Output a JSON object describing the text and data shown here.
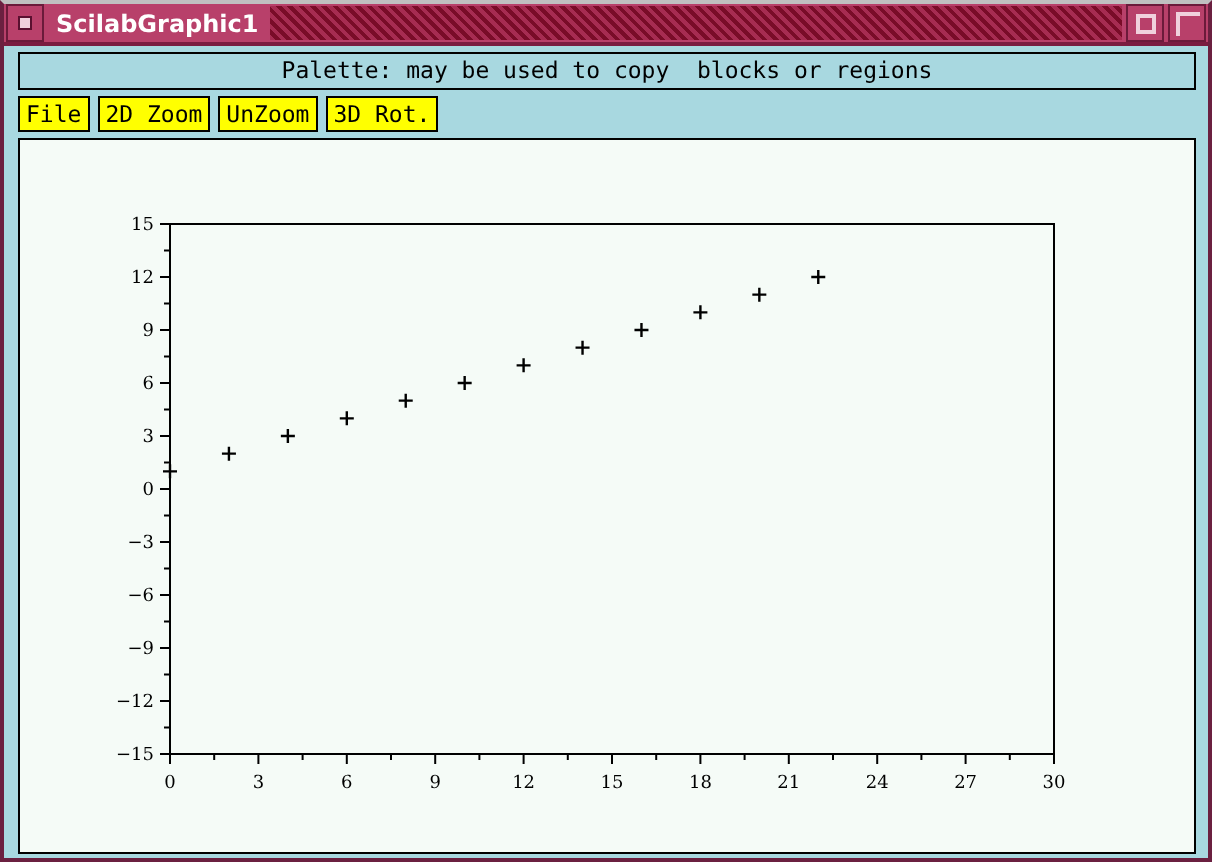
{
  "window": {
    "title": "ScilabGraphic1"
  },
  "palette_message": "Palette: may be used to copy  blocks or regions",
  "menu_buttons": [
    "File",
    "2D Zoom",
    "UnZoom",
    "3D Rot."
  ],
  "chart_data": {
    "type": "scatter",
    "x": [
      0,
      2,
      4,
      6,
      8,
      10,
      12,
      14,
      16,
      18,
      20,
      22
    ],
    "series": [
      {
        "color": "#000000",
        "values": [
          1,
          2,
          3,
          4,
          5,
          6,
          7,
          8,
          9,
          10,
          11,
          12
        ]
      }
    ],
    "xlim": [
      0,
      30
    ],
    "ylim": [
      -15,
      15
    ],
    "xticks": [
      0,
      3,
      6,
      9,
      12,
      15,
      18,
      21,
      24,
      27,
      30
    ],
    "yticks": [
      -15,
      -12,
      -9,
      -6,
      -3,
      0,
      3,
      6,
      9,
      12,
      15
    ]
  }
}
